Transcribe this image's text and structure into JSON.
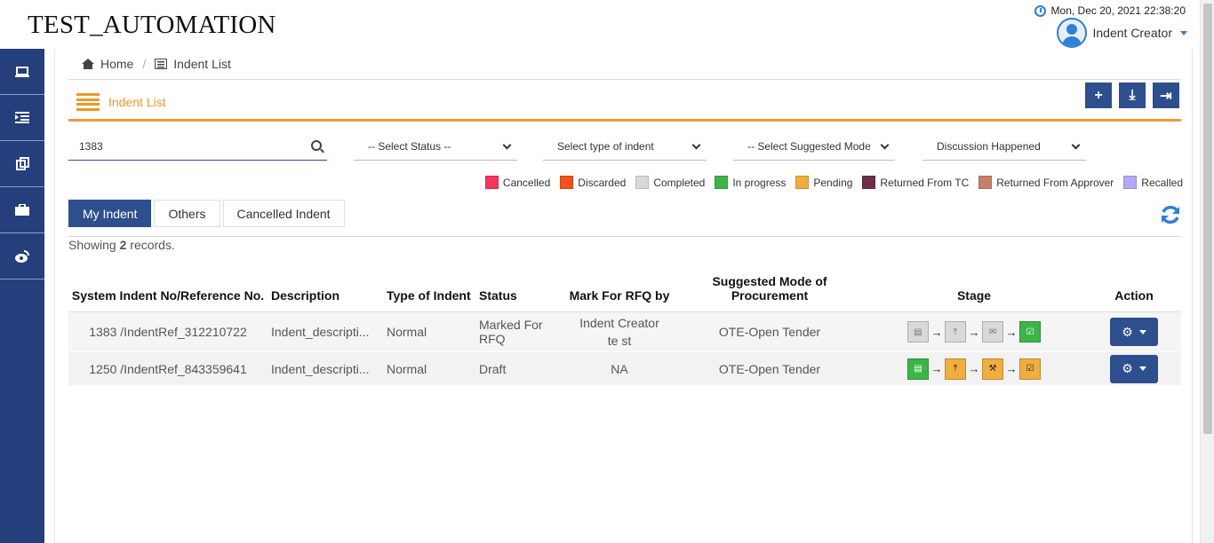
{
  "app": {
    "title": "TEST_AUTOMATION",
    "datetime": "Mon, Dec 20, 2021 22:38:20",
    "user": "Indent Creator"
  },
  "sidebar": {
    "items": [
      {
        "icon": "laptop-icon"
      },
      {
        "icon": "indent-icon"
      },
      {
        "icon": "copy-icon"
      },
      {
        "icon": "briefcase-icon"
      },
      {
        "icon": "weibo-icon"
      }
    ]
  },
  "breadcrumb": {
    "home": "Home",
    "current": "Indent List"
  },
  "page": {
    "title": "Indent List"
  },
  "toolbar": {
    "add": "+",
    "download": "⤓",
    "export": "⇥"
  },
  "filters": {
    "search_value": "1383",
    "status": "-- Select Status --",
    "indent_type": "Select type of indent",
    "suggested_mode": "-- Select Suggested Mode c",
    "discussion": "Discussion Happened"
  },
  "legend": [
    {
      "label": "Cancelled",
      "color": "#f4355e"
    },
    {
      "label": "Discarded",
      "color": "#f4511e"
    },
    {
      "label": "Completed",
      "color": "#d9d9d9"
    },
    {
      "label": "In progress",
      "color": "#3cb44a"
    },
    {
      "label": "Pending",
      "color": "#f0ad40"
    },
    {
      "label": "Returned From TC",
      "color": "#6d2e46"
    },
    {
      "label": "Returned From Approver",
      "color": "#c87f66"
    },
    {
      "label": "Recalled",
      "color": "#b4a7f5"
    }
  ],
  "tabs": [
    {
      "label": "My Indent",
      "active": true
    },
    {
      "label": "Others",
      "active": false
    },
    {
      "label": "Cancelled Indent",
      "active": false
    }
  ],
  "records": {
    "prefix": "Showing ",
    "count": "2",
    "suffix": " records."
  },
  "table": {
    "headers": [
      "System Indent No/Reference No.",
      "Description",
      "Type of Indent",
      "Status",
      "Mark For RFQ by",
      "Suggested Mode of Procurement",
      "Stage",
      "Action"
    ],
    "rows": [
      {
        "indent": "1383 /IndentRef_312210722",
        "description": "Indent_descripti...",
        "type": "Normal",
        "status": "Marked For RFQ",
        "rfq_by": "Indent Creator te st",
        "mode": "OTE-Open Tender",
        "stages": [
          "gray",
          "gray",
          "gray",
          "green"
        ]
      },
      {
        "indent": "1250 /IndentRef_843359641",
        "description": "Indent_descripti...",
        "type": "Normal",
        "status": "Draft",
        "rfq_by": "NA",
        "mode": "OTE-Open Tender",
        "stages": [
          "green",
          "orange",
          "orange",
          "orange"
        ]
      }
    ]
  }
}
